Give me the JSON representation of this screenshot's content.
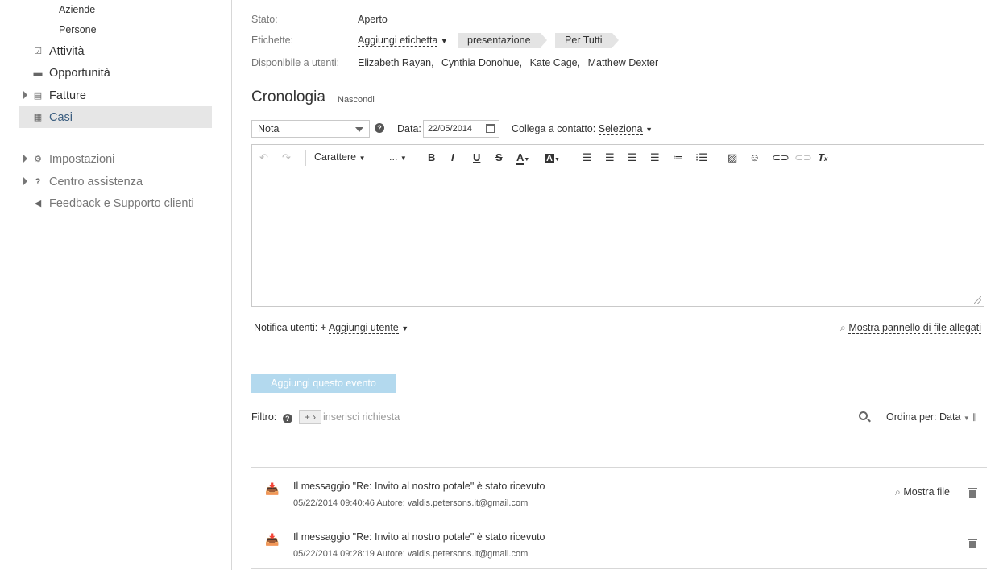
{
  "sidebar": {
    "sub_items": [
      "Aziende",
      "Persone"
    ],
    "items": [
      {
        "label": "Attività",
        "icon": "check-icon"
      },
      {
        "label": "Opportunità",
        "icon": "briefcase-icon"
      },
      {
        "label": "Fatture",
        "icon": "invoice-icon"
      },
      {
        "label": "Casi",
        "icon": "case-icon"
      },
      {
        "label": "Impostazioni",
        "icon": "gear-icon"
      },
      {
        "label": "Centro assistenza",
        "icon": "question-icon"
      },
      {
        "label": "Feedback e Supporto clienti",
        "icon": "megaphone-icon"
      }
    ]
  },
  "props": {
    "status_label": "Stato:",
    "status_value": "Aperto",
    "tags_label": "Etichette:",
    "add_tag": "Aggiungi etichetta",
    "tags": [
      "presentazione",
      "Per Tutti"
    ],
    "users_label": "Disponibile a utenti:",
    "users": [
      "Elizabeth Rayan,",
      "Cynthia Donohue,",
      "Kate Cage,",
      "Matthew Dexter"
    ]
  },
  "history": {
    "title": "Cronologia",
    "hide_link": "Nascondi",
    "type_value": "Nota",
    "date_label": "Data:",
    "date_value": "22/05/2014",
    "contact_label": "Collega a contatto:",
    "contact_value": "Seleziona"
  },
  "toolbar": {
    "font_label": "Carattere",
    "size_label": "..."
  },
  "notify": {
    "label": "Notifica utenti:",
    "add_user": "Aggiungi utente",
    "attach_panel": "Mostra pannello di file allegati"
  },
  "add_event_button": "Aggiungi questo evento",
  "filter": {
    "label": "Filtro:",
    "placeholder": "inserisci richiesta",
    "sort_label": "Ordina per:",
    "sort_value": "Data"
  },
  "events": [
    {
      "title": "Il messaggio \"Re: Invito al nostro potale\" è stato ricevuto",
      "meta": "05/22/2014 09:40:46 Autore: valdis.petersons.it@gmail.com",
      "show_files": "Mostra file"
    },
    {
      "title": "Il messaggio \"Re: Invito al nostro potale\" è stato ricevuto",
      "meta": "05/22/2014 09:28:19 Autore: valdis.petersons.it@gmail.com"
    }
  ],
  "colors": {
    "accent": "#3b5e80",
    "button": "#b3d9ee",
    "active_bg": "#e6e6e6"
  }
}
